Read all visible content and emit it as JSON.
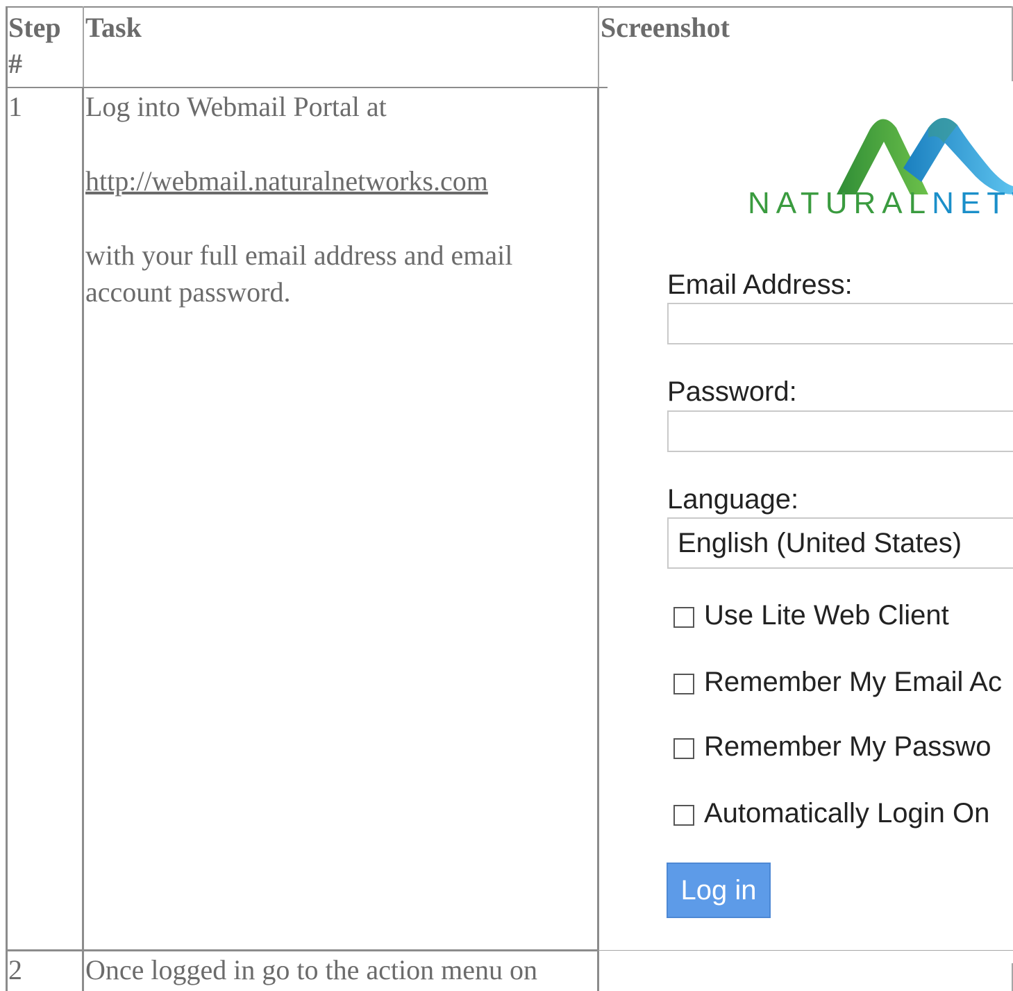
{
  "table": {
    "headers": {
      "step": "Step #",
      "task": "Task",
      "screenshot": "Screenshot"
    },
    "rows": [
      {
        "step": "1",
        "task_line1": "Log into Webmail Portal at",
        "task_link": "http://webmail.naturalnetworks.com",
        "task_line2": "with your full email address and email account password."
      },
      {
        "step": "2",
        "task_line1": "Once logged in go to the action menu on"
      }
    ]
  },
  "login_screenshot": {
    "logo_icon": "natural-networks-wave-logo",
    "logo_text_part1": "NATURAL",
    "logo_text_part2": "NETW",
    "email_label": "Email Address:",
    "email_value": "",
    "password_label": "Password:",
    "password_value": "",
    "language_label": "Language:",
    "language_value": "English (United States)",
    "checkboxes": [
      {
        "label": "Use Lite Web Client",
        "checked": false
      },
      {
        "label": "Remember My Email Ac",
        "checked": false
      },
      {
        "label": "Remember My Passwo",
        "checked": false
      },
      {
        "label": "Automatically Login On",
        "checked": false
      }
    ],
    "login_button": "Log in",
    "colors": {
      "logo_green": "#3a9b3f",
      "logo_blue": "#1b8fc9",
      "button_blue": "#5d9be8"
    }
  }
}
